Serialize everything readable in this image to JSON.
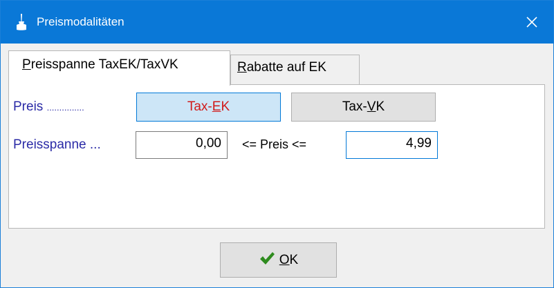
{
  "window": {
    "title": "Preismodalitäten",
    "icon": "paintbrush-icon",
    "close_icon": "close-icon",
    "close_glyph": "✕"
  },
  "tabs": [
    {
      "label_first": "P",
      "label_rest": "reisspanne TaxEK/TaxVK",
      "active": true
    },
    {
      "label_first": "R",
      "label_rest": "abatte auf EK",
      "active": false
    }
  ],
  "price_row": {
    "label": "Preis",
    "dots": "...............",
    "options": [
      {
        "pre": "Tax-",
        "mnemonic": "E",
        "post": "K",
        "selected": true
      },
      {
        "pre": "Tax-",
        "mnemonic": "V",
        "post": "K",
        "selected": false
      }
    ]
  },
  "range_row": {
    "label": "Preisspanne ...",
    "from_value": "0,00",
    "between_text": "<= Preis <=",
    "to_value": "4,99"
  },
  "ok_button": {
    "mnemonic": "O",
    "rest": "K",
    "icon": "checkmark-icon"
  },
  "colors": {
    "titlebar": "#0a78d7",
    "label_blue": "#2a2aa6",
    "selected_text_red": "#d11a1a",
    "checkmark_green": "#2e8b1e"
  }
}
